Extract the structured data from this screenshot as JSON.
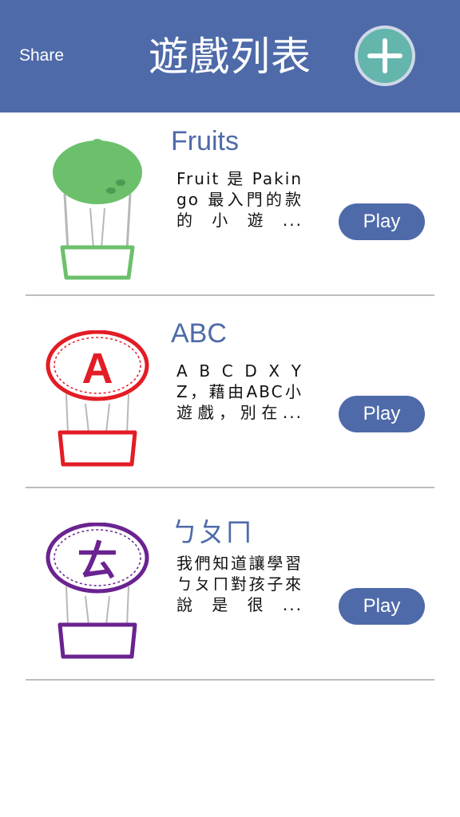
{
  "header": {
    "share_label": "Share",
    "title": "遊戲列表",
    "add_icon": "plus-icon"
  },
  "games": [
    {
      "name": "Fruits",
      "description": "Fruit 是 Pakingo 最入門的款的小遊...",
      "play_label": "Play",
      "icon": "green-lime-balloon-icon",
      "color": "#6cc06c"
    },
    {
      "name": "ABC",
      "description": "A B C D X Y Z，藉由ABC小遊戲，別在...",
      "play_label": "Play",
      "icon": "letter-a-balloon-icon",
      "icon_letter": "A",
      "color": "#e31c25"
    },
    {
      "name": "ㄅㄆㄇ",
      "description": "我們知道讓學習ㄅㄆㄇ對孩子來說是很...",
      "play_label": "Play",
      "icon": "bopomofo-balloon-icon",
      "icon_letter": "ㄊ",
      "color": "#6a2390"
    }
  ],
  "colors": {
    "header_bg": "#4e6aa9",
    "accent_button": "#64b5ac",
    "title_text": "#4e6aa9"
  }
}
